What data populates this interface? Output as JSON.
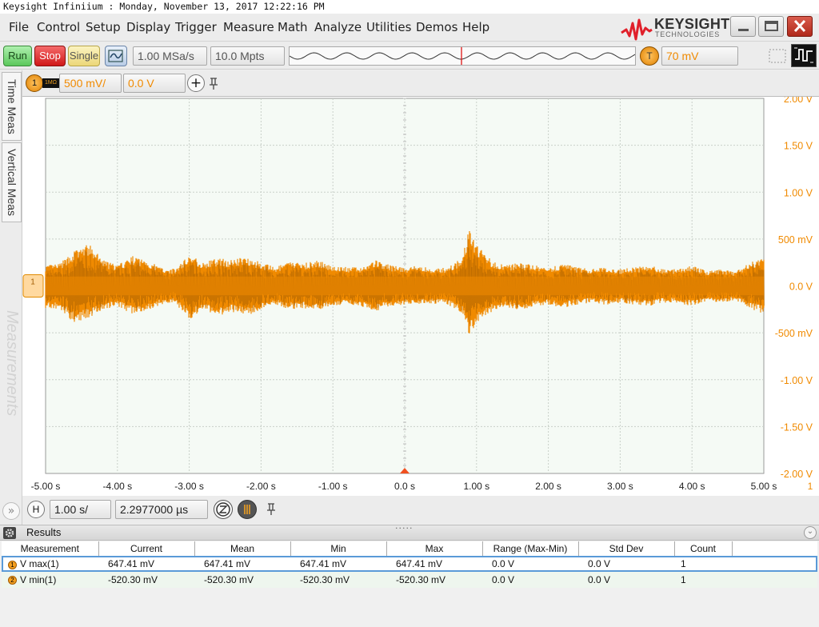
{
  "window": {
    "title": "Keysight Infiniium : Monday, November 13, 2017 12:22:16 PM"
  },
  "menu": [
    "File",
    "Control",
    "Setup",
    "Display",
    "Trigger",
    "Measure",
    "Math",
    "Analyze",
    "Utilities",
    "Demos",
    "Help"
  ],
  "brand": {
    "name": "KEYSIGHT",
    "sub": "TECHNOLOGIES"
  },
  "toolbar": {
    "run_label": "Run",
    "stop_label": "Stop",
    "single_label": "Single",
    "sample_rate": "1.00 MSa/s",
    "memory_depth": "10.0 Mpts",
    "trigger_badge": "T",
    "trigger_level": "70 mV"
  },
  "channel": {
    "number": "1",
    "impedance": "1MΩ",
    "scale": "500 mV/",
    "offset": "0.0 V"
  },
  "sidebar": {
    "tabs": [
      "Time Meas",
      "Vertical Meas"
    ],
    "watermark": "Measurements"
  },
  "timebase": {
    "badge": "H",
    "scale": "1.00 s/",
    "position": "2.2977000 µs"
  },
  "chart_data": {
    "type": "line",
    "x_ticks": [
      "-5.00 s",
      "-4.00 s",
      "-3.00 s",
      "-2.00 s",
      "-1.00 s",
      "0.0 s",
      "1.00 s",
      "2.00 s",
      "3.00 s",
      "4.00 s",
      "5.00 s"
    ],
    "y_ticks": [
      "2.00 V",
      "1.50 V",
      "1.00 V",
      "500 mV",
      "0.0 V",
      "-500 mV",
      "-1.00 V",
      "-1.50 V",
      "-2.00 V"
    ],
    "xlim": [
      -5,
      5
    ],
    "ylim": [
      -2,
      2
    ],
    "channel_marker": "1",
    "series": [
      {
        "color": "#f08a00",
        "envelope_x": [
          -5.0,
          -4.8,
          -4.6,
          -4.4,
          -4.2,
          -4.0,
          -3.8,
          -3.6,
          -3.4,
          -3.2,
          -3.0,
          -2.8,
          -2.6,
          -2.4,
          -2.2,
          -2.0,
          -1.8,
          -1.6,
          -1.4,
          -1.2,
          -1.0,
          -0.8,
          -0.6,
          -0.4,
          -0.2,
          0.0,
          0.2,
          0.4,
          0.6,
          0.8,
          0.9,
          1.0,
          1.2,
          1.4,
          1.6,
          1.8,
          2.0,
          2.2,
          2.4,
          2.6,
          2.8,
          3.0,
          3.2,
          3.4,
          3.6,
          3.8,
          4.0,
          4.2,
          4.4,
          4.6,
          4.8,
          5.0
        ],
        "envelope_max": [
          0.22,
          0.24,
          0.38,
          0.45,
          0.28,
          0.22,
          0.32,
          0.28,
          0.2,
          0.18,
          0.34,
          0.25,
          0.3,
          0.28,
          0.32,
          0.25,
          0.2,
          0.26,
          0.25,
          0.27,
          0.22,
          0.2,
          0.2,
          0.28,
          0.22,
          0.2,
          0.22,
          0.18,
          0.2,
          0.3,
          0.62,
          0.45,
          0.28,
          0.22,
          0.25,
          0.22,
          0.2,
          0.24,
          0.2,
          0.18,
          0.2,
          0.18,
          0.2,
          0.22,
          0.18,
          0.18,
          0.22,
          0.16,
          0.18,
          0.15,
          0.25,
          0.3
        ],
        "envelope_min": [
          -0.24,
          -0.25,
          -0.4,
          -0.34,
          -0.26,
          -0.22,
          -0.3,
          -0.28,
          -0.2,
          -0.18,
          -0.36,
          -0.26,
          -0.32,
          -0.28,
          -0.32,
          -0.26,
          -0.2,
          -0.25,
          -0.24,
          -0.26,
          -0.22,
          -0.2,
          -0.22,
          -0.27,
          -0.22,
          -0.2,
          -0.2,
          -0.19,
          -0.2,
          -0.3,
          -0.52,
          -0.42,
          -0.28,
          -0.22,
          -0.26,
          -0.22,
          -0.2,
          -0.24,
          -0.2,
          -0.18,
          -0.2,
          -0.18,
          -0.2,
          -0.22,
          -0.18,
          -0.18,
          -0.22,
          -0.16,
          -0.18,
          -0.15,
          -0.24,
          -0.3
        ]
      }
    ]
  },
  "results": {
    "title": "Results",
    "columns": [
      "Measurement",
      "Current",
      "Mean",
      "Min",
      "Max",
      "Range (Max-Min)",
      "Std Dev",
      "Count"
    ],
    "rows": [
      {
        "source": "1",
        "cells": [
          "V max(1)",
          "647.41 mV",
          "647.41 mV",
          "647.41 mV",
          "647.41 mV",
          "0.0 V",
          "0.0 V",
          "1"
        ]
      },
      {
        "source": "2",
        "cells": [
          "V min(1)",
          "-520.30 mV",
          "-520.30 mV",
          "-520.30 mV",
          "-520.30 mV",
          "0.0 V",
          "0.0 V",
          "1"
        ]
      }
    ]
  },
  "colors": {
    "trace": "#f08a00",
    "grid": "#c9d0c9",
    "plot_bg": "#f5faf5",
    "close_button": "#c0392b",
    "run_button": "#7fd07f",
    "stop_button": "#e03030",
    "single_button": "#f2e08a"
  }
}
